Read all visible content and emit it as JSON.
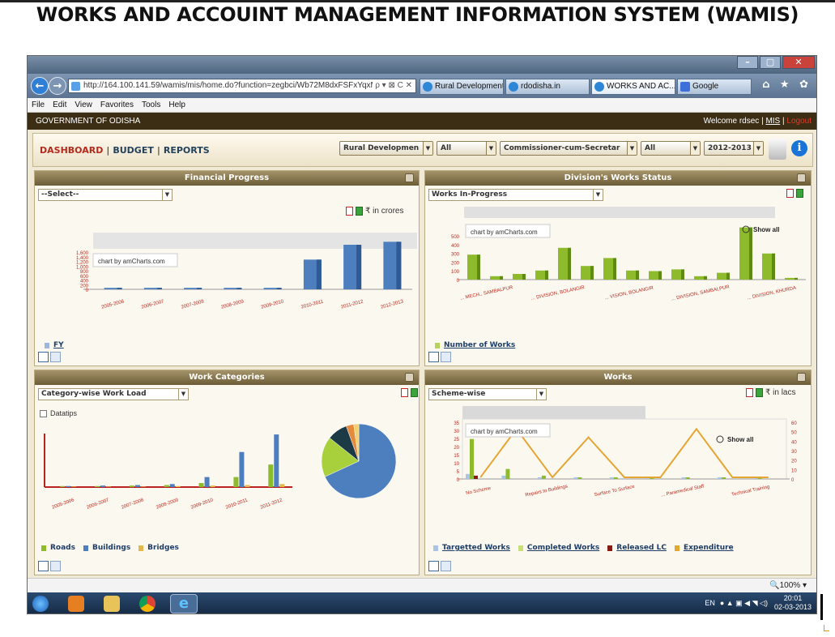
{
  "slide_title": "WORKS AND ACCOUINT MANAGEMENT INFORMATION SYSTEM (WAMIS)",
  "browser": {
    "address": "http://164.100.141.59/wamis/mis/home.do?function=zegbci/Wb72M8dxFSFxYqxMNU8x",
    "address_tools": "ρ ▾ ⊠ C ✕",
    "tabs": [
      "Rural Development ...",
      "rdodisha.in",
      "WORKS AND AC...  ✕",
      "Google"
    ],
    "menu": [
      "File",
      "Edit",
      "View",
      "Favorites",
      "Tools",
      "Help"
    ],
    "nav_icons": "⌂ ★ ✿",
    "status_zoom": "🔍100%  ▾"
  },
  "header": {
    "gov": "GOVERNMENT OF ODISHA",
    "welcome": "Welcome rdsec  |",
    "mis": "MIS",
    "sep": "|",
    "logout": "Logout",
    "nav": {
      "dashboard": "DASHBOARD",
      "sep": "|",
      "budget": "BUDGET",
      "reports": "REPORTS"
    },
    "filters": [
      "Rural Developmen",
      "All",
      "Commissioner-cum-Secretar",
      "All",
      "2012-2013"
    ],
    "arrow": "▼",
    "info": "i"
  },
  "panels": {
    "financial": {
      "title": "Financial Progress",
      "select": "--Select--",
      "unit": "₹ in crores",
      "watermark": "chart by amCharts.com",
      "legend": "FY",
      "chart_data": {
        "type": "bar",
        "title": "Financial Progress",
        "categories": [
          "2005-2006",
          "2006-2007",
          "2007-2008",
          "2008-2009",
          "2009-2010",
          "2010-2011",
          "2011-2012",
          "2012-2013"
        ],
        "values": [
          50,
          50,
          50,
          50,
          50,
          1000,
          1500,
          1600
        ],
        "ylabel": "₹ in crores",
        "ylim": [
          0,
          1800
        ],
        "y_ticks": [
          "1,600",
          "1,400",
          "1,200",
          "1,000",
          "800",
          "600",
          "400",
          "200",
          "0"
        ],
        "legend": "bottom-left"
      }
    },
    "division": {
      "title": "Division's Works Status",
      "select": "Works In-Progress",
      "watermark": "chart by amCharts.com",
      "show_all": "Show all",
      "legend": "Number of Works",
      "chart_data": {
        "type": "bar",
        "title": "Division's Works Status",
        "categories": [
          "... MECH., SAMBALPUR",
          "...",
          "... DIVISION, BOLANGIR",
          "...",
          "... VISION, BOLANGIR",
          "...",
          "...",
          "... DIVISION, SAMBALPUR",
          "...",
          "...",
          "... DIVISION, KHURDA",
          "...",
          "..."
        ],
        "tick_labels": [
          "... MECH., SAMBALPUR",
          "... DIVISION, BOLANGIR",
          "... VISION, BOLANGIR",
          "... DIVISION, SAMBALPUR",
          "... DIVISION, KHURDA"
        ],
        "values": [
          220,
          30,
          50,
          80,
          280,
          120,
          190,
          80,
          75,
          90,
          30,
          60,
          460,
          230,
          15
        ],
        "ylim": [
          0,
          500
        ],
        "y_ticks": [
          "500",
          "400",
          "300",
          "200",
          "100",
          "0"
        ],
        "legend": "bottom-left"
      }
    },
    "categories": {
      "title": "Work Categories",
      "select": "Category-wise Work Load",
      "datatips": "Datatips",
      "legend": [
        "Roads",
        "Buildings",
        "Bridges"
      ],
      "chart_data": [
        {
          "type": "bar",
          "categories": [
            "2005-2006",
            "2006-2007",
            "2007-2008",
            "2008-2009",
            "2009-2010",
            "2010-2011",
            "2011-2012"
          ],
          "series": [
            {
              "name": "Roads",
              "values": [
                2,
                2,
                3,
                4,
                8,
                20,
                45
              ]
            },
            {
              "name": "Buildings",
              "values": [
                2,
                3,
                4,
                6,
                20,
                70,
                105
              ]
            },
            {
              "name": "Bridges",
              "values": [
                1,
                1,
                1,
                2,
                3,
                4,
                6
              ]
            }
          ],
          "legend": "bottom-left"
        },
        {
          "type": "pie",
          "values": [
            62,
            16,
            8,
            3,
            2
          ]
        }
      ]
    },
    "works": {
      "title": "Works",
      "select": "Scheme-wise",
      "unit": "₹ in lacs",
      "watermark": "chart by amCharts.com",
      "show_all": "Show all",
      "legend": [
        "Targetted Works",
        "Completed Works",
        "Released LC",
        "Expenditure"
      ],
      "chart_data": {
        "type": "bar",
        "categories": [
          "No Scheme",
          "...",
          "Repairs to Buildings",
          "...",
          "Surface To Surface",
          "...",
          "... Paramedical Staff",
          "...",
          "Technical Training"
        ],
        "tick_labels": [
          "No Scheme",
          "Repairs to Buildings",
          "Surface To Surface",
          "... Paramedical Staff",
          "Technical Training"
        ],
        "series": [
          {
            "name": "Targetted Works",
            "values": [
              3,
              2,
              1,
              1,
              1,
              1,
              1,
              1,
              1
            ]
          },
          {
            "name": "Completed Works",
            "values": [
              24,
              6,
              2,
              1,
              1,
              1,
              1,
              1,
              1
            ]
          },
          {
            "name": "Released LC",
            "values": [
              2,
              0,
              0,
              0,
              0,
              0,
              0,
              0,
              0
            ]
          },
          {
            "name": "Expenditure",
            "values": [
              1,
              30,
              1,
              25,
              1,
              1,
              30,
              1,
              1
            ]
          }
        ],
        "ylim": [
          0,
          35
        ],
        "y_ticks": [
          "35",
          "30",
          "25",
          "20",
          "15",
          "10",
          "5",
          "0"
        ],
        "y2_ticks": [
          "60",
          "50",
          "40",
          "30",
          "20",
          "10",
          "0"
        ],
        "legend": "bottom-left"
      }
    }
  },
  "taskbar": {
    "lang": "EN",
    "time": "20:01",
    "date": "02-03-2013"
  },
  "colors": {
    "panel_head": "#7d6c44",
    "bar_blue": "#4d7fbf",
    "bar_green": "#8dbb2c",
    "line_orange": "#e5a533",
    "line_red": "#c0281c",
    "logout_red": "#e03b2a"
  }
}
